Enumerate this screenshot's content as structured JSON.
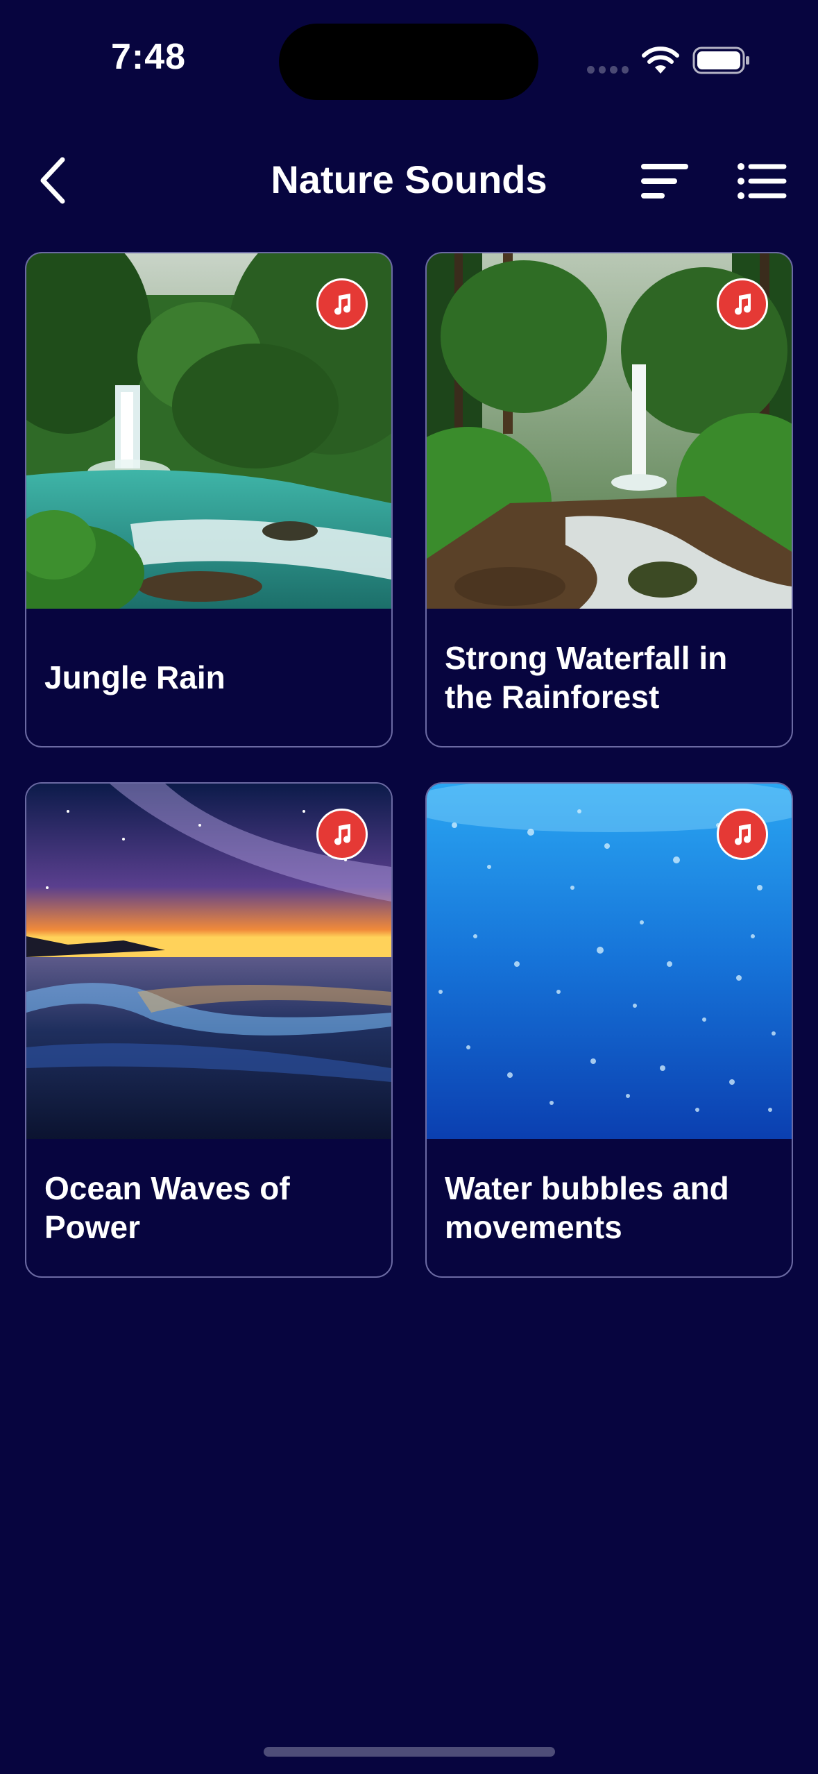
{
  "status_bar": {
    "time": "7:48"
  },
  "nav": {
    "title": "Nature Sounds",
    "back_icon": "chevron-left-icon",
    "sort_icon": "sort-icon",
    "list_icon": "list-icon"
  },
  "cards": [
    {
      "title": "Jungle Rain",
      "badge_icon": "music-note-icon"
    },
    {
      "title": "Strong Waterfall in the Rainforest",
      "badge_icon": "music-note-icon"
    },
    {
      "title": "Ocean Waves of Power",
      "badge_icon": "music-note-icon"
    },
    {
      "title": "Water bubbles and movements",
      "badge_icon": "music-note-icon"
    }
  ],
  "colors": {
    "background": "#07053f",
    "card_border": "#6b6aa3",
    "badge": "#e53935",
    "text": "#ffffff"
  }
}
